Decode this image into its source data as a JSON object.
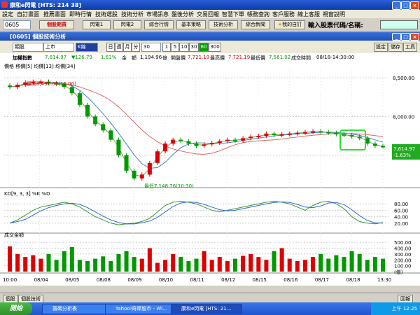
{
  "window": {
    "title": "康和e閃電 [HTS: 214 38]"
  },
  "menu": [
    "設定",
    "自訂畫面",
    "推薦畫面",
    "即時行情",
    "技術選股",
    "技術分析",
    "市場訊息",
    "盤後分析",
    "交易回報",
    "智慧下單",
    "帳務查詢",
    "客戶服務",
    "線上客服",
    "視窗說明"
  ],
  "toolbar": {
    "stock_code": "0605",
    "buttons": [
      "個股期貨",
      "閃電1",
      "閃電2",
      "綜合行情",
      "基本策略",
      "技術分析",
      "綜合新聞"
    ],
    "favorite": "我的自訂",
    "right_label": "輸入股票代碼/名稱:"
  },
  "panel": {
    "title": "[0605] 個股技術分析"
  },
  "controls": {
    "type_select": "類股",
    "market_select": "上市",
    "chart_select": "K線",
    "periods": [
      "日",
      "週",
      "月",
      "分"
    ],
    "minutes": "30",
    "interval_buttons": [
      "1",
      "5",
      "10",
      "30",
      "60",
      "300"
    ],
    "active_interval": "60",
    "right_buttons": [
      "設定",
      "儲存",
      "工具"
    ]
  },
  "info": {
    "name": "加權指數",
    "price": "7,614.97",
    "change": "▼126.79",
    "pct": "1.63%",
    "amount_label": "金",
    "amount_label2": "額",
    "amount": "1,194.96",
    "unit": "億",
    "open_label": "開盤價",
    "open": "7,721.19",
    "high_label": "最高價",
    "high": "7,721.19",
    "low_label": "最低價",
    "low": "7,561.02",
    "time_label": "成交時間",
    "time": "08/18-14:30:00"
  },
  "chart_data": {
    "type": "line",
    "price_legend": "價格 移價[5] 均價[13] 均價[34]",
    "kd_legend": "KD[9, 3, 3] %K %D",
    "vol_legend": "成交金額",
    "x_labels": [
      "10:00",
      "08/04",
      "08/05",
      "08/08",
      "08/09",
      "08/10",
      "08/11",
      "08/12",
      "08/15",
      "08/16",
      "08/17",
      "08/18",
      "13:30"
    ],
    "y_price_ticks": [
      "8,500.00",
      "8,000.00",
      "7,500.00"
    ],
    "y_kd_ticks": [
      "80.00",
      "60.00",
      "40.00",
      "20.00"
    ],
    "y_vol_ticks": [
      "500.00",
      "400.00",
      "300.00",
      "200.00",
      "100.00",
      "(億)"
    ],
    "high_annotation": "最高8,496.07(10:00)",
    "low_annotation": "最低7,148.76(10:30)",
    "last_price": "7,614.97",
    "last_change": "-1.63%",
    "close": [
      8380,
      8410,
      8440,
      8450,
      8450,
      8430,
      8420,
      8380,
      8300,
      8150,
      8000,
      7900,
      7820,
      7700,
      7500,
      7300,
      7200,
      7250,
      7400,
      7550,
      7650,
      7700,
      7680,
      7650,
      7620,
      7640,
      7660,
      7680,
      7700,
      7690,
      7720,
      7740,
      7750,
      7780,
      7760,
      7770,
      7780,
      7790,
      7800,
      7810,
      7800,
      7790,
      7770,
      7760,
      7740,
      7720,
      7650,
      7620,
      7615
    ],
    "kd_k": [
      20,
      30,
      45,
      60,
      70,
      75,
      80,
      85,
      80,
      70,
      55,
      40,
      30,
      20,
      15,
      18,
      20,
      25,
      35,
      55,
      75,
      85,
      88,
      85,
      80,
      70,
      60,
      55,
      60,
      65,
      70,
      75,
      80,
      85,
      88,
      85,
      80,
      70,
      60,
      75,
      85,
      88,
      80,
      65,
      40,
      25,
      20,
      18,
      22
    ],
    "volume": [
      430,
      300,
      250,
      280,
      220,
      300,
      200,
      350,
      420,
      200,
      180,
      220,
      260,
      180,
      300,
      350,
      250,
      220,
      400,
      150,
      200,
      300,
      250,
      180,
      220,
      350,
      200,
      250,
      180,
      220,
      270,
      300,
      250,
      200,
      350,
      400,
      220,
      180,
      200,
      250,
      300,
      220,
      280,
      250,
      350,
      300,
      200,
      250,
      220
    ]
  },
  "bottom_tabs": [
    "個股",
    "個股技術"
  ],
  "bottom_right": "回報",
  "taskbar": {
    "start": "開始",
    "items": [
      "籌碼分析表",
      "Yahoo!奇摩股市 - Wi...",
      "康和e閃電 [HTS: 21..."
    ],
    "tray_time": "上午 12:25",
    "tray_label": "回報"
  }
}
